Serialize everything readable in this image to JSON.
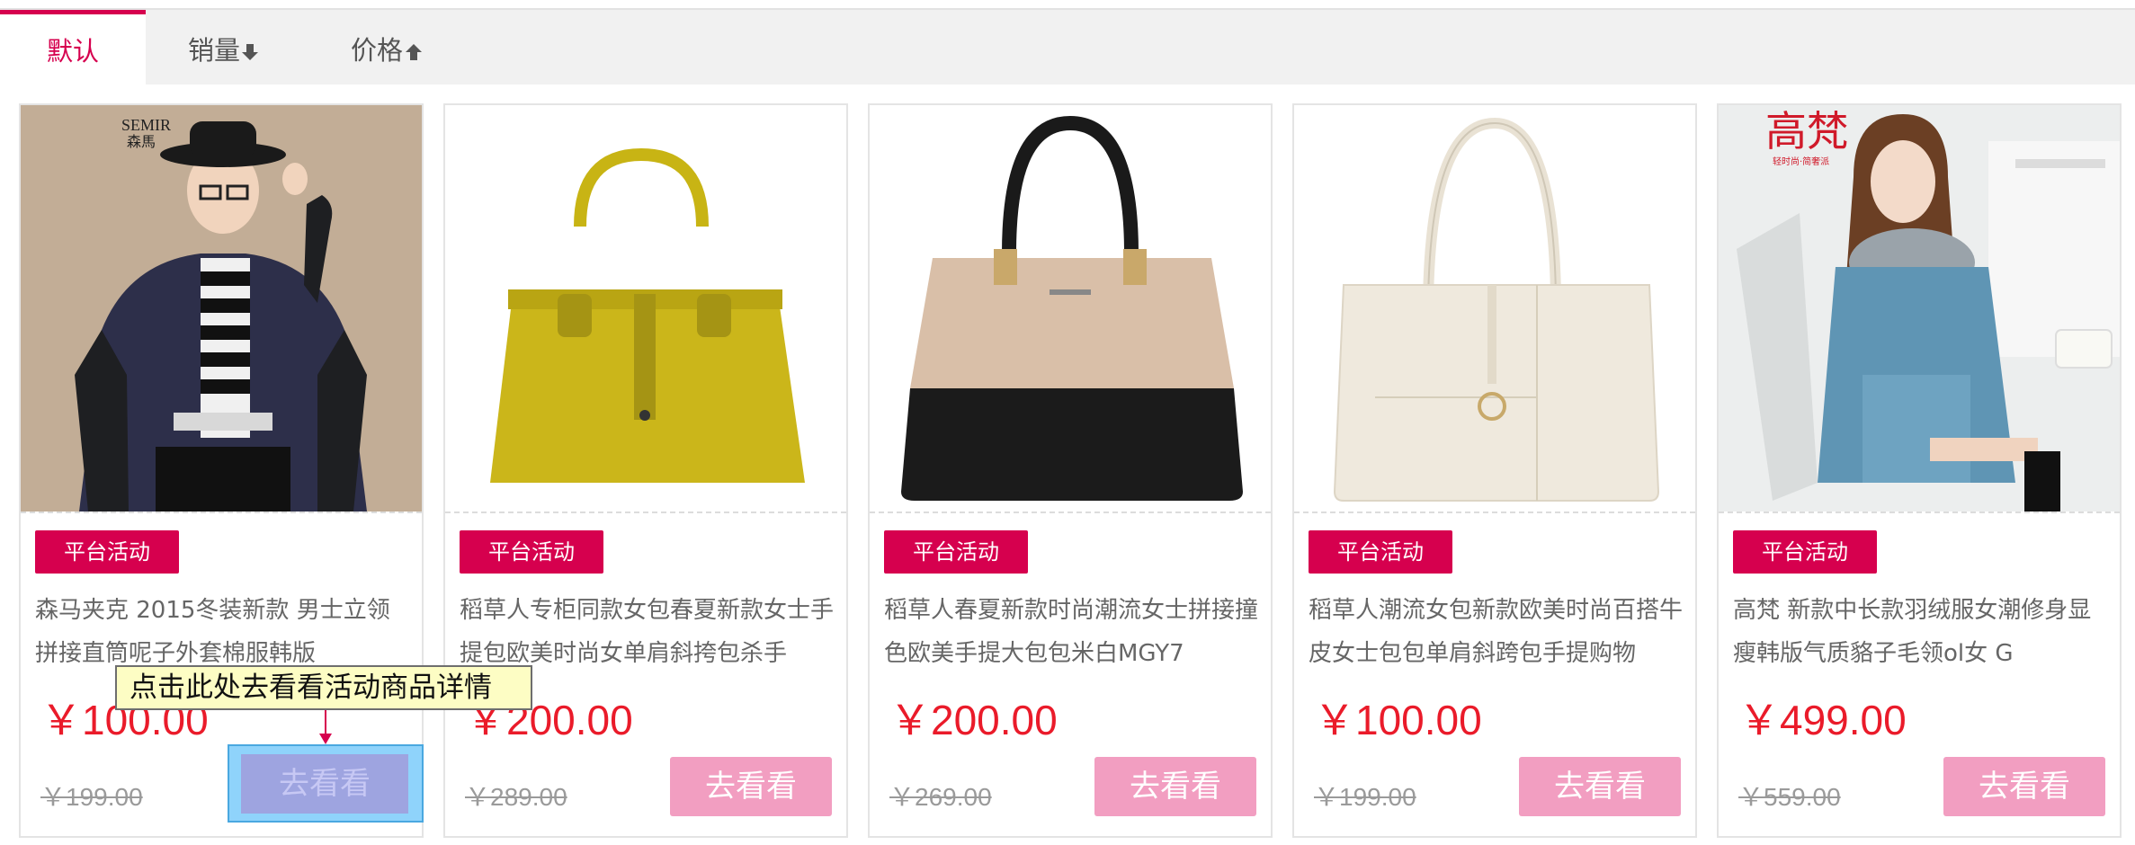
{
  "tabs": {
    "default": "默认",
    "sales": "销量",
    "price": "价格"
  },
  "products": [
    {
      "badge": "平台活动",
      "title": "森马夹克 2015冬装新款 男士立领拼接直筒呢子外套棉服韩版",
      "price": "￥100.00",
      "old_price": "￥199.00",
      "button": "去看看",
      "brand": "SEMIR 森馬"
    },
    {
      "badge": "平台活动",
      "title": "稻草人专柜同款女包春夏新款女士手提包欧美时尚女单肩斜挎包杀手",
      "price": "￥200.00",
      "old_price": "￥289.00",
      "button": "去看看"
    },
    {
      "badge": "平台活动",
      "title": "稻草人春夏新款时尚潮流女士拼接撞色欧美手提大包包米白MGY7",
      "price": "￥200.00",
      "old_price": "￥269.00",
      "button": "去看看"
    },
    {
      "badge": "平台活动",
      "title": "稻草人潮流女包新款欧美时尚百搭牛皮女士包包单肩斜跨包手提购物",
      "price": "￥100.00",
      "old_price": "￥199.00",
      "button": "去看看"
    },
    {
      "badge": "平台活动",
      "title": "高梵 新款中长款羽绒服女潮修身显瘦韩版气质貉子毛领ol女 G",
      "price": "￥499.00",
      "old_price": "￥559.00",
      "button": "去看看",
      "brand": "高梵"
    }
  ],
  "tooltip": "点击此处去看看活动商品详情",
  "colors": {
    "accent": "#d6004e",
    "price": "#ea1b2a",
    "button": "#f29ec1",
    "tooltip_bg": "#fdfdc4",
    "highlight": "#8fd3fb"
  }
}
